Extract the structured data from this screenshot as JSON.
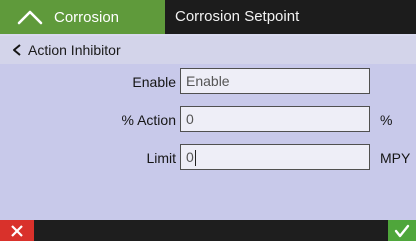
{
  "topbar": {
    "back_label": "Corrosion",
    "title": "Corrosion Setpoint"
  },
  "subbar": {
    "label": "Action Inhibitor"
  },
  "form": {
    "enable": {
      "label": "Enable",
      "value": "Enable"
    },
    "action": {
      "label": "% Action",
      "value": "0",
      "unit": "%"
    },
    "limit": {
      "label": "Limit",
      "value": "0",
      "unit": "MPY"
    }
  },
  "icons": {
    "back": "chevron-up-icon",
    "sub_back": "chevron-left-icon",
    "cancel": "close-icon",
    "confirm": "check-icon"
  },
  "colors": {
    "accent_green": "#5f9a3b",
    "cancel_red": "#d9312b",
    "confirm_green": "#4fa63b",
    "form_background": "#c8c9ea"
  }
}
